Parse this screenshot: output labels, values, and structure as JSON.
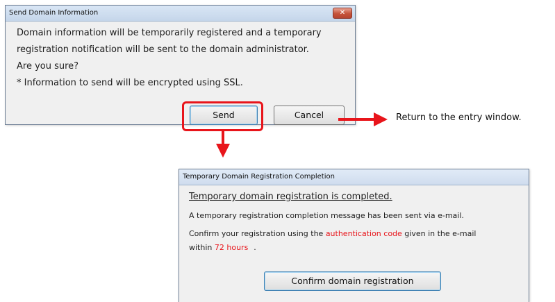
{
  "dialog1": {
    "title": "Send Domain Information",
    "close_glyph": "✕",
    "message_lines": [
      "Domain information will be temporarily registered and a temporary",
      "registration notification will be sent to the domain administrator.",
      "Are you sure?",
      "* Information to send will be encrypted using SSL."
    ],
    "send_label": "Send",
    "cancel_label": "Cancel"
  },
  "annotation": {
    "cancel_note": "Return to the entry window.",
    "accent_color": "#e8151b"
  },
  "dialog2": {
    "title": "Temporary Domain Registration Completion",
    "heading": "Temporary domain registration is completed.",
    "sent_message": "A temporary registration completion message has been sent via e-mail.",
    "confirm_prefix": "Confirm your registration using the ",
    "auth_code": "authentication code",
    "confirm_suffix": " given in the e-mail",
    "within_prefix": "within ",
    "hours": "72 hours",
    "within_suffix": ".",
    "confirm_button": "Confirm domain registration"
  }
}
